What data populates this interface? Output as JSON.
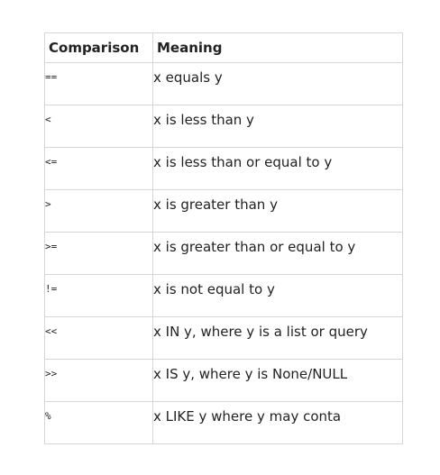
{
  "table": {
    "headers": [
      "Comparison",
      "Meaning"
    ],
    "rows": [
      {
        "operator": "==",
        "meaning": "x equals y"
      },
      {
        "operator": "<",
        "meaning": "x is less than y"
      },
      {
        "operator": "<=",
        "meaning": "x is less than or equal to y"
      },
      {
        "operator": ">",
        "meaning": "x is greater than y"
      },
      {
        "operator": ">=",
        "meaning": "x is greater than or equal to y"
      },
      {
        "operator": "!=",
        "meaning": "x is not equal to y"
      },
      {
        "operator": "<<",
        "meaning": "x IN y, where y is a list or query"
      },
      {
        "operator": ">>",
        "meaning": "x IS y, where y is None/NULL"
      },
      {
        "operator": "%",
        "meaning": "x LIKE y where y may conta"
      }
    ]
  }
}
